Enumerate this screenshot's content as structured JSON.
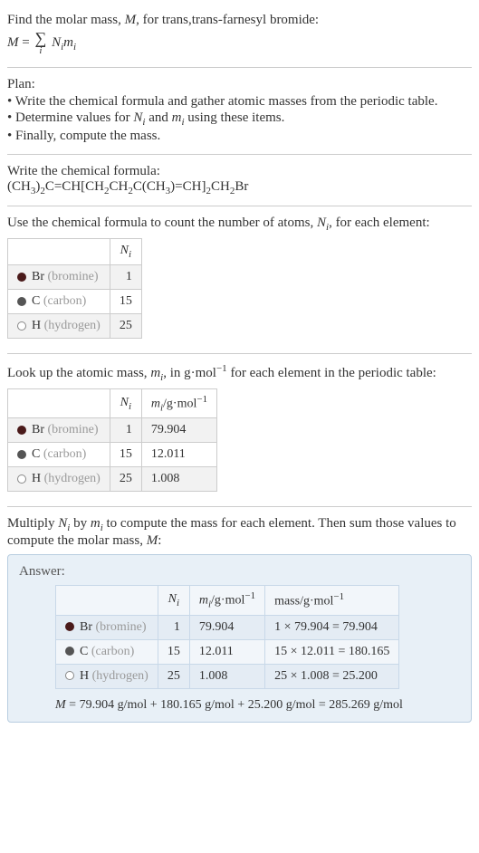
{
  "intro": {
    "line1_pre": "Find the molar mass, ",
    "line1_M": "M",
    "line1_post": ", for trans,trans-farnesyl bromide:",
    "formula_lhs": "M",
    "formula_eq": " = ",
    "sigma_sub": "i",
    "formula_rhs_N": "N",
    "formula_rhs_Nsub": "i",
    "formula_rhs_m": "m",
    "formula_rhs_msub": "i"
  },
  "plan": {
    "title": "Plan:",
    "items": [
      "• Write the chemical formula and gather atomic masses from the periodic table.",
      "• Determine values for ",
      "• Finally, compute the mass."
    ],
    "item2_N": "N",
    "item2_Nsub": "i",
    "item2_mid": " and ",
    "item2_m": "m",
    "item2_msub": "i",
    "item2_end": " using these items."
  },
  "chemformula": {
    "title": "Write the chemical formula:",
    "parts": [
      "(CH",
      "3",
      ")",
      "2",
      "C=CH[CH",
      "2",
      "CH",
      "2",
      "C(CH",
      "3",
      ")=CH]",
      "2",
      "CH",
      "2",
      "Br"
    ]
  },
  "count": {
    "title_pre": "Use the chemical formula to count the number of atoms, ",
    "title_N": "N",
    "title_Nsub": "i",
    "title_post": ", for each element:",
    "header_Ni": "N",
    "header_Ni_sub": "i",
    "rows": [
      {
        "elem": "Br",
        "elem_gray": "(bromine)",
        "n": "1"
      },
      {
        "elem": "C",
        "elem_gray": "(carbon)",
        "n": "15"
      },
      {
        "elem": "H",
        "elem_gray": "(hydrogen)",
        "n": "25"
      }
    ]
  },
  "mass": {
    "title_pre": "Look up the atomic mass, ",
    "title_m": "m",
    "title_msub": "i",
    "title_mid": ", in g·mol",
    "title_exp": "−1",
    "title_post": " for each element in the periodic table:",
    "header_Ni": "N",
    "header_Ni_sub": "i",
    "header_mi": "m",
    "header_mi_sub": "i",
    "header_mi_unit": "/g·mol",
    "header_mi_exp": "−1",
    "rows": [
      {
        "elem": "Br",
        "elem_gray": "(bromine)",
        "n": "1",
        "m": "79.904"
      },
      {
        "elem": "C",
        "elem_gray": "(carbon)",
        "n": "15",
        "m": "12.011"
      },
      {
        "elem": "H",
        "elem_gray": "(hydrogen)",
        "n": "25",
        "m": "1.008"
      }
    ]
  },
  "multiply": {
    "text_pre": "Multiply ",
    "N": "N",
    "Nsub": "i",
    "text_mid1": " by ",
    "m": "m",
    "msub": "i",
    "text_mid2": " to compute the mass for each element. Then sum those values to compute the molar mass, ",
    "M": "M",
    "text_end": ":"
  },
  "answer": {
    "label": "Answer:",
    "header_Ni": "N",
    "header_Ni_sub": "i",
    "header_mi": "m",
    "header_mi_sub": "i",
    "header_mi_unit": "/g·mol",
    "header_mi_exp": "−1",
    "header_mass": "mass/g·mol",
    "header_mass_exp": "−1",
    "rows": [
      {
        "elem": "Br",
        "elem_gray": "(bromine)",
        "n": "1",
        "m": "79.904",
        "calc": "1 × 79.904 = 79.904"
      },
      {
        "elem": "C",
        "elem_gray": "(carbon)",
        "n": "15",
        "m": "12.011",
        "calc": "15 × 12.011 = 180.165"
      },
      {
        "elem": "H",
        "elem_gray": "(hydrogen)",
        "n": "25",
        "m": "1.008",
        "calc": "25 × 1.008 = 25.200"
      }
    ],
    "final_M": "M",
    "final_text": " = 79.904 g/mol + 180.165 g/mol + 25.200 g/mol = 285.269 g/mol"
  }
}
